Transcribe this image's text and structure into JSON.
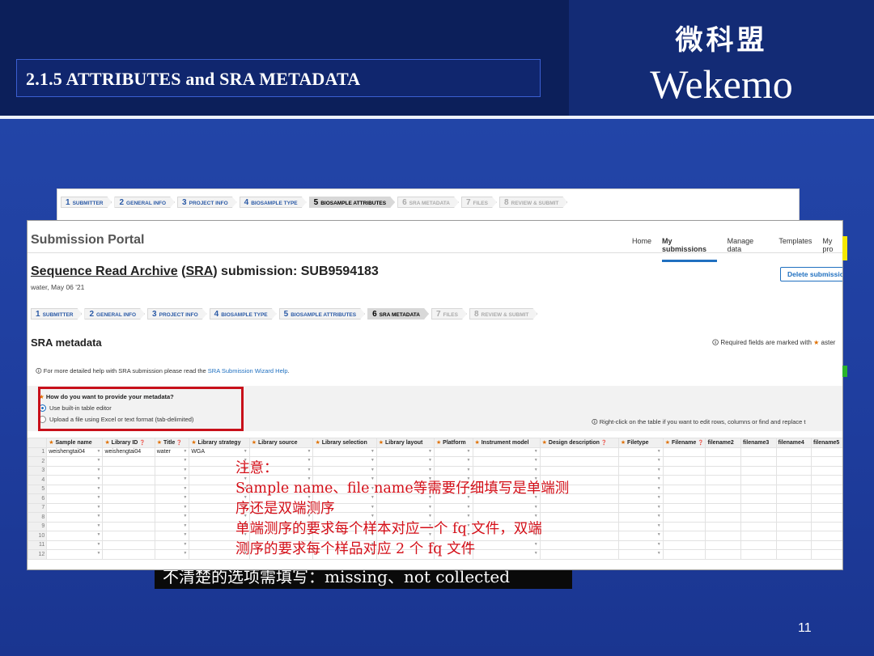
{
  "slide": {
    "title": "2.1.5 ATTRIBUTES and SRA METADATA",
    "logo_cn": "微科盟",
    "logo_en": "Wekemo",
    "page_number": "11",
    "hidden_note": "不清楚的选项需填写：missing、not collected"
  },
  "back_steps": [
    {
      "num": "1",
      "label": "SUBMITTER",
      "state": "done"
    },
    {
      "num": "2",
      "label": "GENERAL INFO",
      "state": "done"
    },
    {
      "num": "3",
      "label": "PROJECT INFO",
      "state": "done"
    },
    {
      "num": "4",
      "label": "BIOSAMPLE TYPE",
      "state": "done"
    },
    {
      "num": "5",
      "label": "BIOSAMPLE ATTRIBUTES",
      "state": "active"
    },
    {
      "num": "6",
      "label": "SRA METADATA",
      "state": "future"
    },
    {
      "num": "7",
      "label": "FILES",
      "state": "future"
    },
    {
      "num": "8",
      "label": "REVIEW & SUBMIT",
      "state": "future"
    }
  ],
  "portal": {
    "title": "Submission Portal",
    "nav": [
      "Home",
      "My submissions",
      "Manage data",
      "Templates",
      "My pro"
    ],
    "nav_current": "My submissions",
    "submission_prefix": "Sequence Read Archive",
    "submission_abbr": "SRA",
    "submission_suffix": "submission: SUB9594183",
    "meta": "water, May 06 '21",
    "delete_label": "Delete submission",
    "section_title": "SRA metadata",
    "required_note": "Required fields are marked with",
    "required_note_tail": "aster",
    "help_prefix": "For more detailed help with SRA submission please read the",
    "help_link": "SRA Submission Wizard Help",
    "question": "How do you want to provide your metadata?",
    "option_builtin": "Use built-in table editor",
    "option_upload": "Upload a file using Excel or text format (tab-delimited)",
    "right_click_note": "Right-click on the table if you want to edit rows, columns or find and replace t"
  },
  "steps": [
    {
      "num": "1",
      "label": "SUBMITTER",
      "state": "done"
    },
    {
      "num": "2",
      "label": "GENERAL INFO",
      "state": "done"
    },
    {
      "num": "3",
      "label": "PROJECT INFO",
      "state": "done"
    },
    {
      "num": "4",
      "label": "BIOSAMPLE TYPE",
      "state": "done"
    },
    {
      "num": "5",
      "label": "BIOSAMPLE ATTRIBUTES",
      "state": "done"
    },
    {
      "num": "6",
      "label": "SRA METADATA",
      "state": "active"
    },
    {
      "num": "7",
      "label": "FILES",
      "state": "future"
    },
    {
      "num": "8",
      "label": "REVIEW & SUBMIT",
      "state": "future"
    }
  ],
  "sheet": {
    "columns": [
      {
        "label": "Sample name",
        "req": true
      },
      {
        "label": "Library ID",
        "req": true,
        "info": true
      },
      {
        "label": "Title",
        "req": true,
        "info": true
      },
      {
        "label": "Library strategy",
        "req": true
      },
      {
        "label": "Library source",
        "req": true
      },
      {
        "label": "Library selection",
        "req": true
      },
      {
        "label": "Library layout",
        "req": true
      },
      {
        "label": "Platform",
        "req": true
      },
      {
        "label": "Instrument model",
        "req": true
      },
      {
        "label": "Design description",
        "req": true,
        "info": true
      },
      {
        "label": "Filetype",
        "req": true
      },
      {
        "label": "Filename",
        "req": true,
        "info": true
      },
      {
        "label": "filename2",
        "req": false
      },
      {
        "label": "filename3",
        "req": false
      },
      {
        "label": "filename4",
        "req": false
      },
      {
        "label": "filename5",
        "req": false
      }
    ],
    "row1": [
      "weishengtai04",
      "weishengtai04",
      "water",
      "WGA",
      "",
      "",
      "",
      "",
      "",
      "",
      "",
      "",
      "",
      "",
      "",
      ""
    ],
    "row_numbers": [
      "1",
      "2",
      "3",
      "4",
      "5",
      "6",
      "7",
      "8",
      "9",
      "10",
      "11",
      "12"
    ]
  },
  "overlay": {
    "line1": "注意：",
    "line2": "Sample name、file name等需要仔细填写是单端测",
    "line3": "序还是双端测序",
    "line4": "单端测序的要求每个样本对应一个 fq 文件，双端",
    "line5": "测序的要求每个样品对应 2 个 fq 文件"
  },
  "colors": {
    "accent": "#2070c0",
    "required_star": "#e07000",
    "highlight_box": "#c8101a",
    "overlay_text": "#d40f18"
  }
}
